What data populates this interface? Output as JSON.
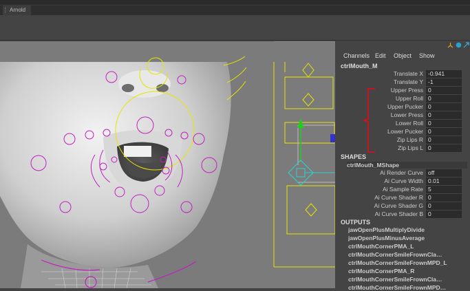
{
  "window": {
    "tab": "Arnold"
  },
  "channel_box": {
    "menu": [
      "Channels",
      "Edit",
      "Object",
      "Show"
    ],
    "icons": [
      "axis-gizmo-icon",
      "sphere-icon",
      "expand-icon"
    ],
    "node": "ctrlMouth_M",
    "channels": [
      {
        "label": "Translate X",
        "value": "-0.941"
      },
      {
        "label": "Translate Y",
        "value": "-1"
      },
      {
        "label": "Upper Press",
        "value": "0"
      },
      {
        "label": "Upper Roll",
        "value": "0"
      },
      {
        "label": "Upper Pucker",
        "value": "0"
      },
      {
        "label": "Lower Press",
        "value": "0"
      },
      {
        "label": "Lower Roll",
        "value": "0"
      },
      {
        "label": "Lower Pucker",
        "value": "0"
      },
      {
        "label": "Zip Lips R",
        "value": "0"
      },
      {
        "label": "Zip Lips L",
        "value": "0"
      }
    ],
    "shapes_header": "SHAPES",
    "shape_node": "ctrlMouth_MShape",
    "shape_channels": [
      {
        "label": "Ai Render Curve",
        "value": "off"
      },
      {
        "label": "Ai Curve Width",
        "value": "0.01"
      },
      {
        "label": "Ai Sample Rate",
        "value": "5"
      },
      {
        "label": "Ai Curve Shader R",
        "value": "0"
      },
      {
        "label": "Ai Curve Shader G",
        "value": "0"
      },
      {
        "label": "Ai Curve Shader B",
        "value": "0"
      }
    ],
    "outputs_header": "OUTPUTS",
    "outputs": [
      "jawOpenPlusMultiplyDivide",
      "jawOpenPlusMinusAverage",
      "ctrlMouthCornerPMA_L",
      "ctrlMouthCornerSmileFrownCla…",
      "ctrlMouthCornerSmileFrownMPD_L",
      "ctrlMouthCornerPMA_R",
      "ctrlMouthCornerSmileFrownCla…",
      "ctrlMouthCornerSmileFrownMPD…"
    ]
  },
  "colors": {
    "control_magenta": "#c01fc0",
    "control_yellow": "#e6e600",
    "annotation_red": "#c8141e",
    "translate_green": "#22cc22",
    "cyan_selected": "#33cccc"
  }
}
